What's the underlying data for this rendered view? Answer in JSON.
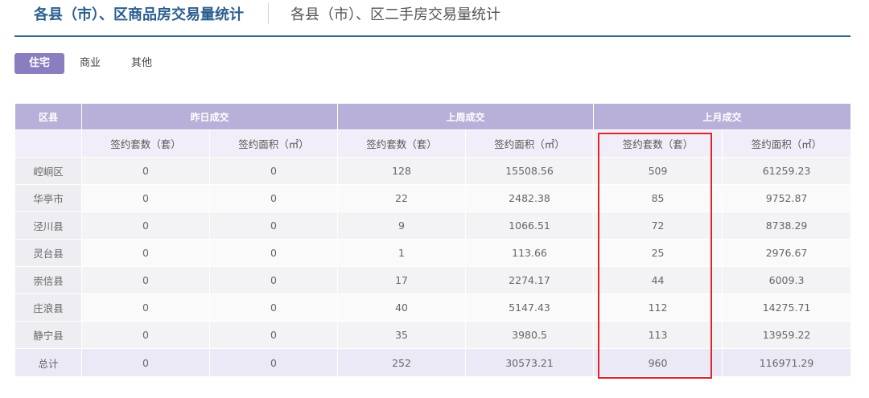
{
  "header": {
    "tab_primary": "各县（市）、区商品房交易量统计",
    "tab_secondary": "各县（市）、区二手房交易量统计"
  },
  "subtabs": [
    "住宅",
    "商业",
    "其他"
  ],
  "table": {
    "group_headers": [
      "区县",
      "昨日成交",
      "上周成交",
      "上月成交"
    ],
    "sub_headers": [
      "签约套数（套）",
      "签约面积（㎡）",
      "签约套数（套）",
      "签约面积（㎡）",
      "签约套数（套）",
      "签约面积（㎡）"
    ],
    "rows": [
      {
        "county": "崆峒区",
        "values": [
          "0",
          "0",
          "128",
          "15508.56",
          "509",
          "61259.23"
        ]
      },
      {
        "county": "华亭市",
        "values": [
          "0",
          "0",
          "22",
          "2482.38",
          "85",
          "9752.87"
        ]
      },
      {
        "county": "泾川县",
        "values": [
          "0",
          "0",
          "9",
          "1066.51",
          "72",
          "8738.29"
        ]
      },
      {
        "county": "灵台县",
        "values": [
          "0",
          "0",
          "1",
          "113.66",
          "25",
          "2976.67"
        ]
      },
      {
        "county": "崇信县",
        "values": [
          "0",
          "0",
          "17",
          "2274.17",
          "44",
          "6009.3"
        ]
      },
      {
        "county": "庄浪县",
        "values": [
          "0",
          "0",
          "40",
          "5147.43",
          "112",
          "14275.71"
        ]
      },
      {
        "county": "静宁县",
        "values": [
          "0",
          "0",
          "35",
          "3980.5",
          "113",
          "13959.22"
        ]
      },
      {
        "county": "总计",
        "values": [
          "0",
          "0",
          "252",
          "30573.21",
          "960",
          "116971.29"
        ]
      }
    ]
  },
  "colors": {
    "header_accent": "#2b5f8f",
    "table_header": "#b8b0d8",
    "active_subtab": "#8b7ec0",
    "highlight": "#e0242c"
  }
}
